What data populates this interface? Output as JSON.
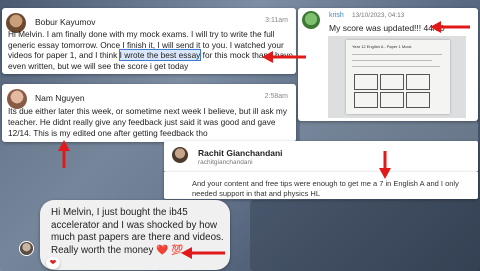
{
  "colors": {
    "arrow": "#e11919",
    "link_blue": "#3b8ac4",
    "highlight": "#dbe8fb"
  },
  "cards": {
    "bobur": {
      "name": "Bobur Kayumov",
      "time": "3:11am",
      "msg_before": "Hi Melvin. I am finally done with my mock exams. I will try to write the full generic essay tomorrow. Once I finish it, I will send it to you. I watched your videos for paper 1, and I think ",
      "msg_highlight": "I wrote the best essay",
      "msg_after": " for this mock than I have even written, but we will see the score i get today"
    },
    "krish": {
      "name": "krish",
      "date": "13/10/2023, 04:13",
      "message": "My score was updated!!! 44/50",
      "paper_title": "Year 12 English A - Paper 1 Mock"
    },
    "nam": {
      "name": "Nam Nguyen",
      "time": "2:58am",
      "message": "Its due either later this week, or sometime next week I believe, but ill ask my teacher. He didnt really give any feedback just said it was good and gave 12/14. This is my edited one after getting feedback tho"
    },
    "rachit": {
      "name": "Rachit Gianchandani",
      "handle": "rachitgianchandani",
      "message": "And your content and free tips were enough to get me a 7 in English A and I only needed support in that and physics HL"
    },
    "bubble": {
      "message": "Hi Melvin, I just bought the ib45 accelerator and I was shocked by how much past papers are there and videos. Really worth the money",
      "emoji": "❤️ 💯",
      "reaction": "❤"
    }
  }
}
